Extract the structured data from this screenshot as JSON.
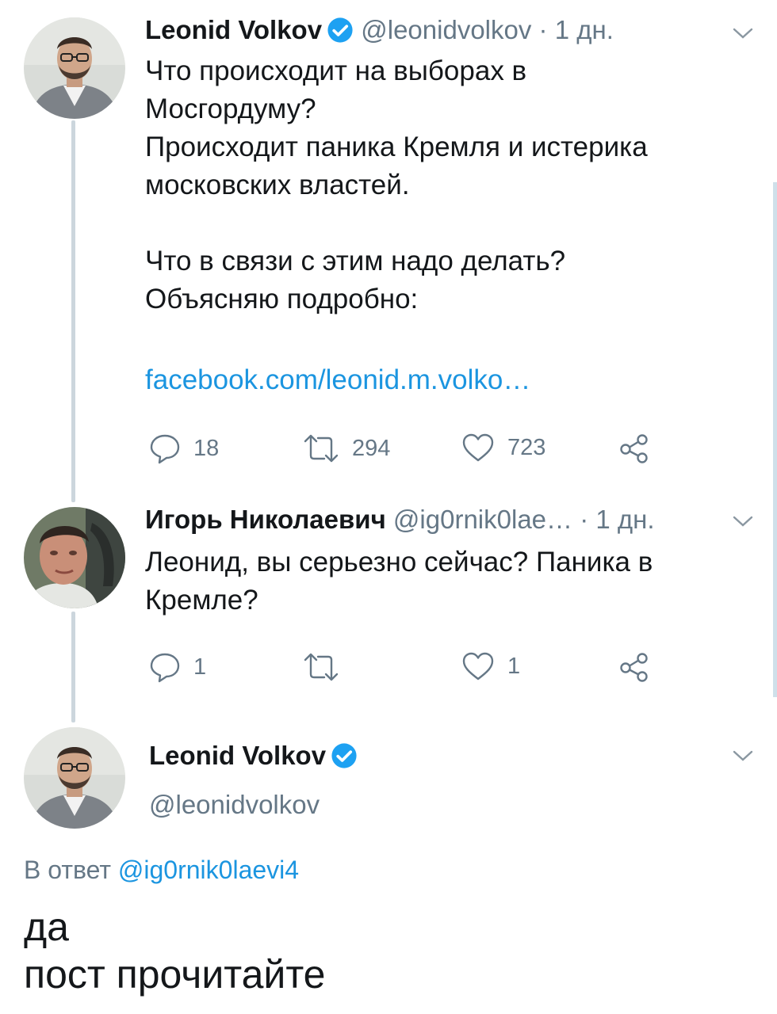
{
  "tweets": [
    {
      "name": "Leonid Volkov",
      "handle": "@leonidvolkov",
      "dot": "·",
      "time": "1 дн.",
      "verified": true,
      "text": "Что происходит на выборах в\nМосгордуму?\nПроисходит паника Кремля и истерика\nмосковских властей.\n\nЧто в связи с этим надо делать?\nОбъясняю подробно:",
      "link": "facebook.com/leonid.m.volko…",
      "replies": "18",
      "retweets": "294",
      "likes": "723"
    },
    {
      "name": "Игорь Николаевич",
      "handle": "@ig0rnik0lae…",
      "dot": "·",
      "time": "1 дн.",
      "verified": false,
      "text": "Леонид, вы серьезно сейчас? Паника в\nКремле?",
      "replies": "1",
      "retweets": "",
      "likes": "1"
    }
  ],
  "focused": {
    "name": "Leonid Volkov",
    "handle": "@leonidvolkov",
    "verified": true,
    "reply_prefix": "В ответ",
    "reply_mention": "@ig0rnik0laevi4",
    "text": "да\nпост прочитайте"
  },
  "icons": {
    "reply": "reply-icon",
    "retweet": "retweet-icon",
    "like": "heart-icon",
    "share": "share-icon",
    "verified": "verified-badge-icon",
    "caret": "chevron-down-icon"
  },
  "colors": {
    "link": "#1b95e0",
    "muted": "#657786",
    "thread_line": "#ccd6dd",
    "verified": "#1da1f2"
  }
}
